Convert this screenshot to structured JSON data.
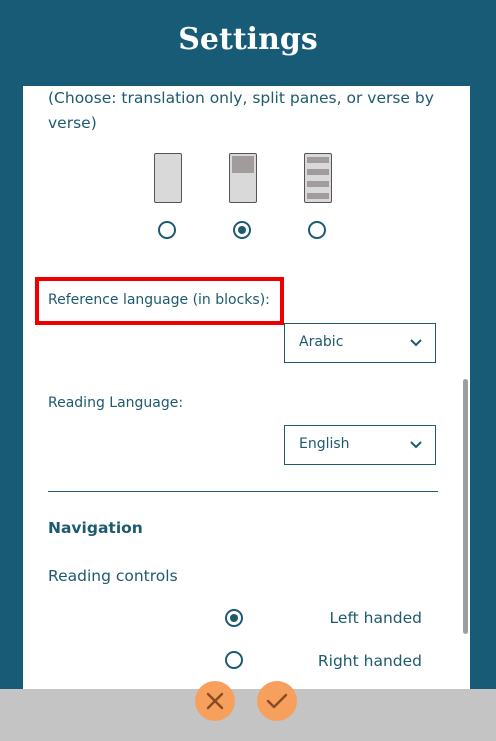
{
  "header": {
    "title": "Settings"
  },
  "layout_section": {
    "hint": "(Choose: translation only, split panes, or verse by verse)",
    "options": [
      {
        "icon": "single-pane-layout-icon",
        "selected": false
      },
      {
        "icon": "split-pane-layout-icon",
        "selected": true
      },
      {
        "icon": "verse-by-verse-layout-icon",
        "selected": false
      }
    ]
  },
  "reference_language": {
    "label": "Reference language (in blocks):",
    "value": "Arabic"
  },
  "reading_language": {
    "label": "Reading Language:",
    "value": "English"
  },
  "navigation": {
    "heading": "Navigation",
    "reading_controls_label": "Reading controls",
    "options": [
      {
        "label": "Left handed",
        "selected": true
      },
      {
        "label": "Right handed",
        "selected": false
      }
    ]
  },
  "footer": {
    "cancel_icon": "close-icon",
    "confirm_icon": "check-icon"
  },
  "colors": {
    "header_bg": "#175b76",
    "text": "#1e5a6f",
    "highlight": "#ee0000",
    "action_button": "#f7a05e",
    "footer_bg": "#c4c4c4"
  }
}
